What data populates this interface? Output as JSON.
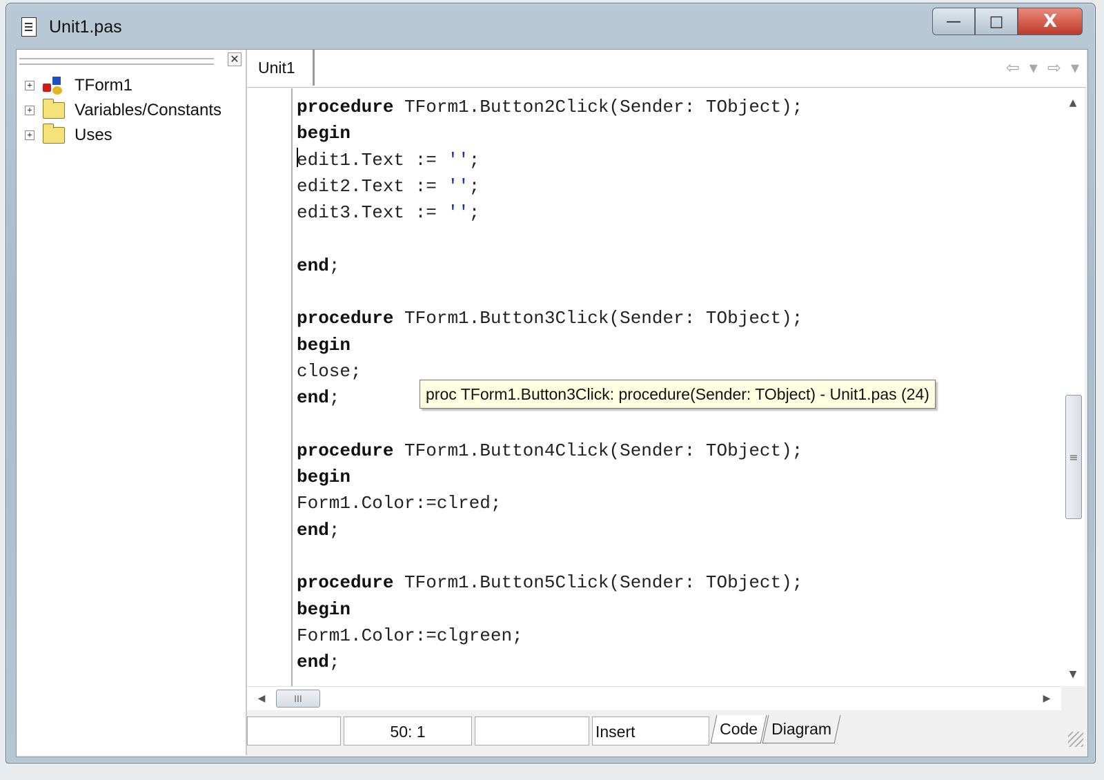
{
  "window": {
    "title": "Unit1.pas",
    "controls": {
      "minimize": "—",
      "maximize": "□",
      "close": "X"
    }
  },
  "left_panel": {
    "close_glyph": "✕",
    "tree": [
      {
        "label": "TForm1",
        "icon": "form-icon",
        "expander": "+"
      },
      {
        "label": "Variables/Constants",
        "icon": "folder-icon",
        "expander": "+"
      },
      {
        "label": "Uses",
        "icon": "folder-icon",
        "expander": "+"
      }
    ]
  },
  "editor": {
    "tab": "Unit1",
    "nav": {
      "back": "⇦",
      "back_drop": "▾",
      "forward": "⇨",
      "forward_drop": "▾"
    },
    "code_lines": [
      [
        {
          "t": "procedure",
          "c": "kw"
        },
        {
          "t": " TForm1.Button2Click(Sender: TObject);",
          "c": ""
        }
      ],
      [
        {
          "t": "begin",
          "c": "kw"
        }
      ],
      [
        {
          "t": "edit1.Text := ",
          "c": ""
        },
        {
          "t": "''",
          "c": "str"
        },
        {
          "t": ";",
          "c": ""
        }
      ],
      [
        {
          "t": "edit2.Text := ",
          "c": ""
        },
        {
          "t": "''",
          "c": "str"
        },
        {
          "t": ";",
          "c": ""
        }
      ],
      [
        {
          "t": "edit3.Text := ",
          "c": ""
        },
        {
          "t": "''",
          "c": "str"
        },
        {
          "t": ";",
          "c": ""
        }
      ],
      [],
      [
        {
          "t": "end",
          "c": "kw"
        },
        {
          "t": ";",
          "c": ""
        }
      ],
      [],
      [
        {
          "t": "procedure",
          "c": "kw"
        },
        {
          "t": " TForm1.Button3Click(Sender: TObject);",
          "c": ""
        }
      ],
      [
        {
          "t": "begin",
          "c": "kw"
        }
      ],
      [
        {
          "t": "close;",
          "c": ""
        }
      ],
      [
        {
          "t": "end",
          "c": "kw"
        },
        {
          "t": ";",
          "c": ""
        }
      ],
      [],
      [
        {
          "t": "procedure",
          "c": "kw"
        },
        {
          "t": " TForm1.Button4Click(Sender: TObject);",
          "c": ""
        }
      ],
      [
        {
          "t": "begin",
          "c": "kw"
        }
      ],
      [
        {
          "t": "Form1.Color:=clred;",
          "c": ""
        }
      ],
      [
        {
          "t": "end",
          "c": "kw"
        },
        {
          "t": ";",
          "c": ""
        }
      ],
      [],
      [
        {
          "t": "procedure",
          "c": "kw"
        },
        {
          "t": " TForm1.Button5Click(Sender: TObject);",
          "c": ""
        }
      ],
      [
        {
          "t": "begin",
          "c": "kw"
        }
      ],
      [
        {
          "t": "Form1.Color:=clgreen;",
          "c": ""
        }
      ],
      [
        {
          "t": "end",
          "c": "kw"
        },
        {
          "t": ";",
          "c": ""
        }
      ]
    ],
    "tooltip": "proc  TForm1.Button3Click: procedure(Sender: TObject) - Unit1.pas (24)",
    "scroll": {
      "up": "▲",
      "down": "▼",
      "left": "◀",
      "right": "▶",
      "vthumb": "≡",
      "hthumb": "III"
    }
  },
  "status": {
    "position": "50:  1",
    "mode": "Insert",
    "view_tabs": {
      "code": "Code",
      "diagram": "Diagram"
    }
  },
  "colors": {
    "string_literal": "#1a2cc0",
    "tooltip_bg": "#ffffe1",
    "close_button": "#c0382a"
  }
}
